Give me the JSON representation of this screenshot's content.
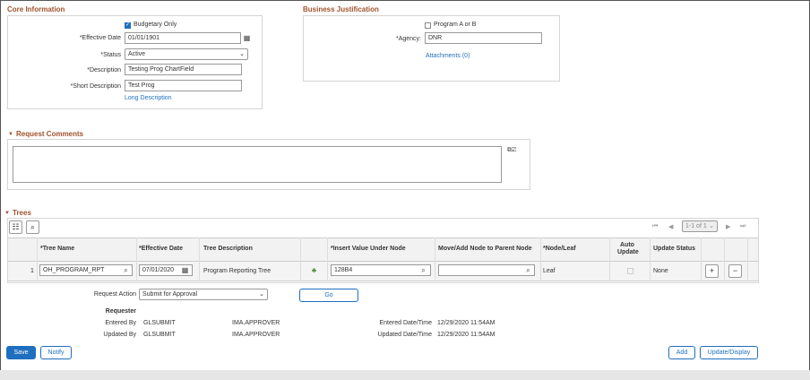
{
  "core": {
    "title": "Core Information",
    "budgetary_only": "Budgetary Only",
    "effective_date_label": "*Effective Date",
    "effective_date": "01/01/1901",
    "status_label": "*Status",
    "status": "Active",
    "description_label": "*Description",
    "description": "Testing Prog ChartField",
    "short_description_label": "*Short Description",
    "short_description": "Test Prog",
    "long_description_link": "Long Description"
  },
  "business": {
    "title": "Business Justification",
    "program_ab": "Program A or B",
    "agency_label": "*Agency:",
    "agency": "DNR",
    "attachments_link": "Attachments (0)"
  },
  "comments": {
    "title": "Request Comments"
  },
  "trees": {
    "title": "Trees",
    "pager": "1-1 of 1",
    "headers": {
      "tree_name": "*Tree Name",
      "effective_date": "*Effective Date",
      "tree_description": "Tree Description",
      "insert_value": "*Insert Value Under Node",
      "move_add": "Move/Add Node to Parent Node",
      "node_leaf": "*Node/Leaf",
      "auto_update_1": "Auto",
      "auto_update_2": "Update",
      "update_status": "Update Status"
    },
    "row": {
      "num": "1",
      "tree_name": "OH_PROGRAM_RPT",
      "effective_date": "07/01/2020",
      "tree_description": "Program Reporting Tree",
      "insert_value": "128B4",
      "move_add": "",
      "node_leaf": "Leaf",
      "update_status": "None"
    }
  },
  "request": {
    "action_label": "Request Action",
    "action": "Submit for Approval",
    "go": "Go",
    "requester_label": "Requester",
    "entered_by_label": "Entered By",
    "entered_by": "GLSUBMIT",
    "entered_by_approver": "IMA.APPROVER",
    "updated_by_label": "Updated By",
    "updated_by": "GLSUBMIT",
    "updated_by_approver": "IMA.APPROVER",
    "entered_dt_label": "Entered Date/Time",
    "entered_dt": "12/29/2020 11:54AM",
    "updated_dt_label": "Updated Date/Time",
    "updated_dt": "12/29/2020 11:54AM"
  },
  "buttons": {
    "save": "Save",
    "notify": "Notify",
    "add": "Add",
    "update_display": "Update/Display"
  }
}
